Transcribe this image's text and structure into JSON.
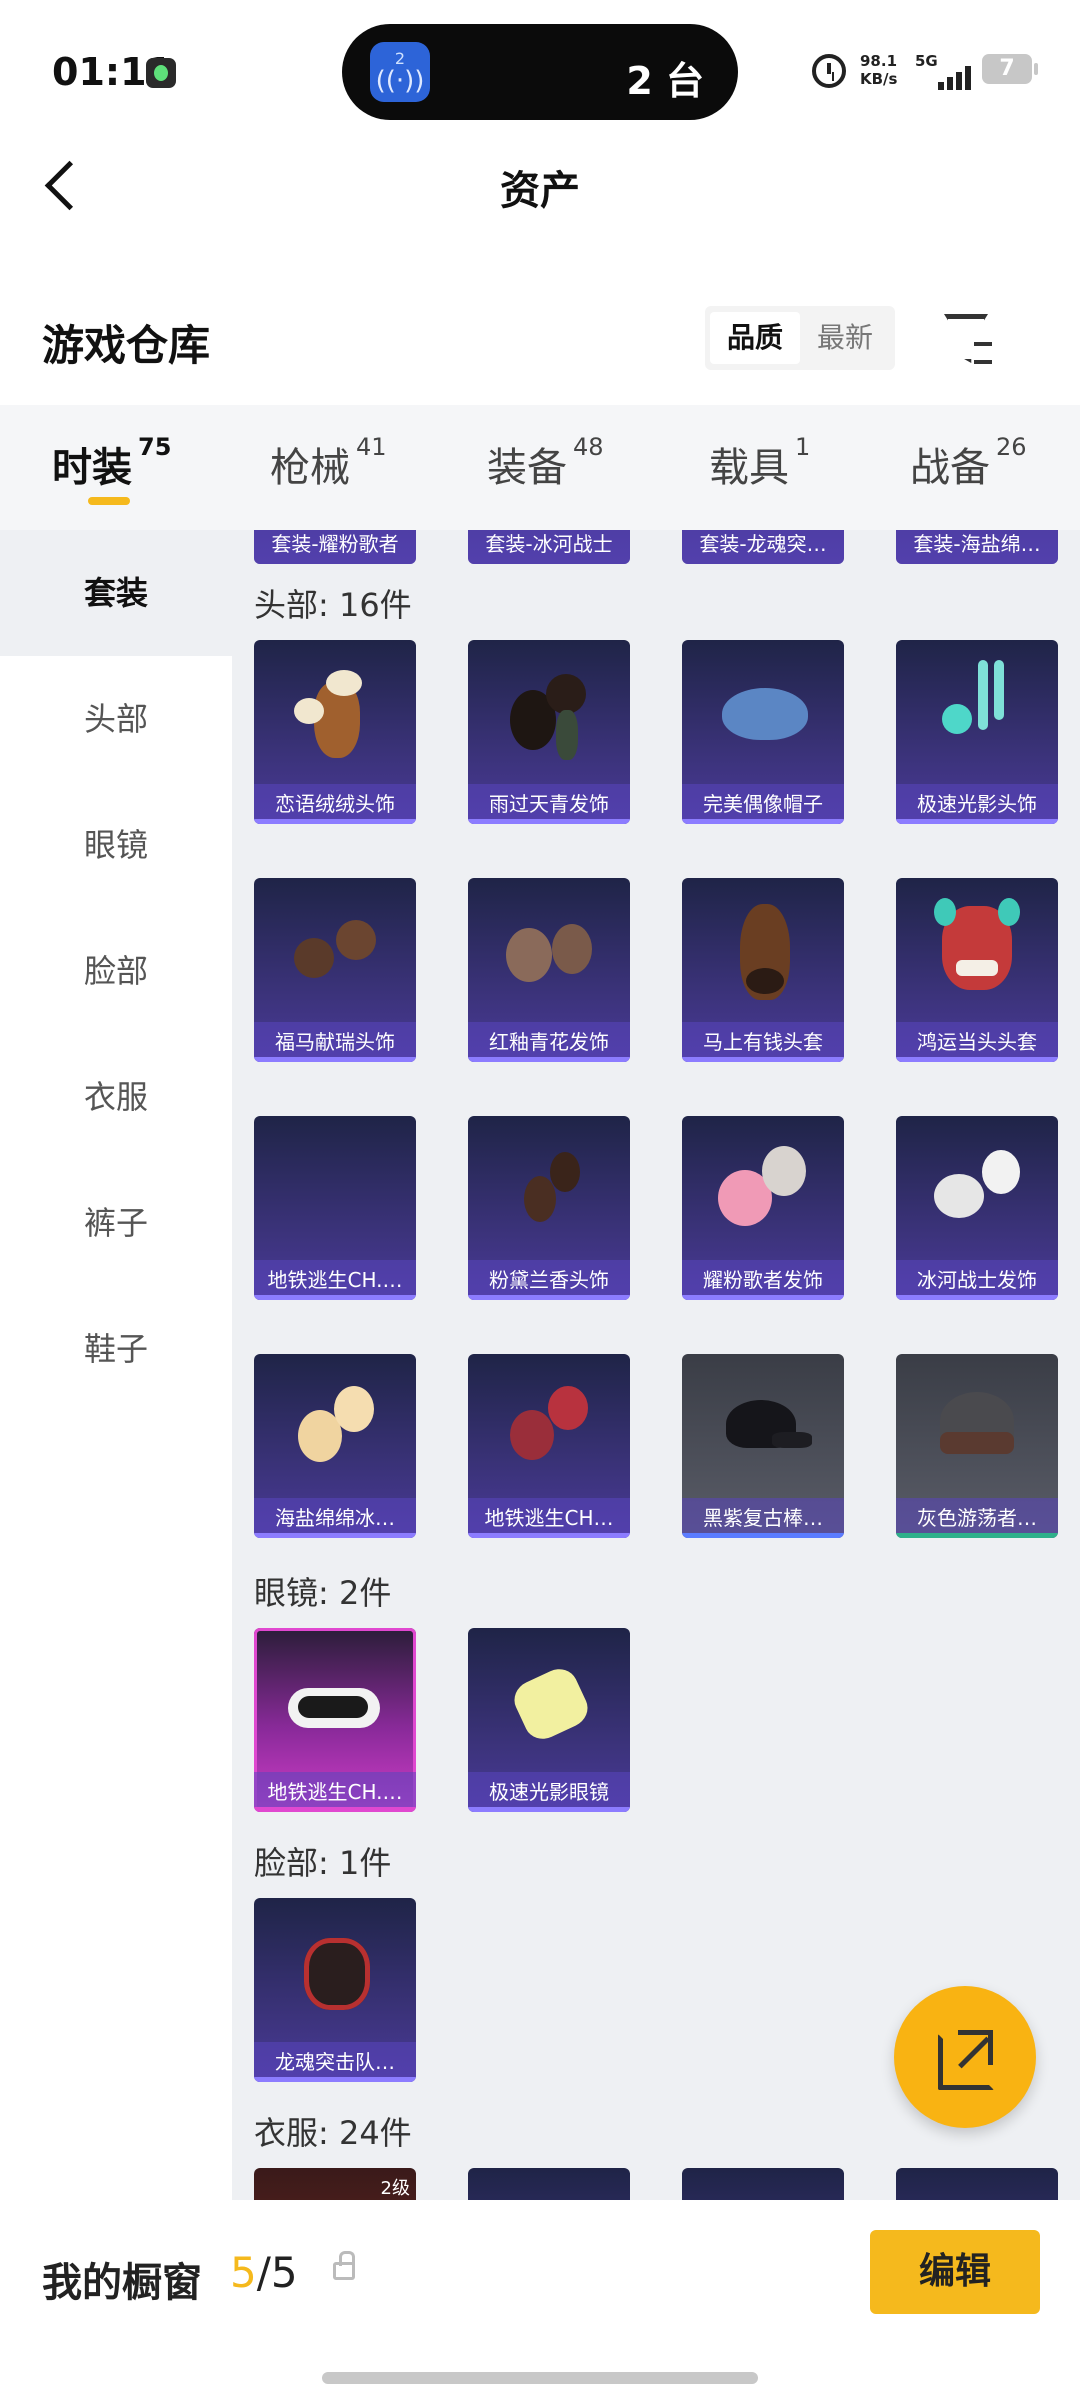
{
  "status_bar": {
    "time": "01:11",
    "island_icon_number": "2",
    "island_text": "2 台",
    "net_speed": "98.1",
    "net_unit": "KB/s",
    "signal": "5G",
    "battery": "7"
  },
  "header": {
    "title": "资产"
  },
  "warehouse": {
    "title": "游戏仓库",
    "sort_options": [
      "品质",
      "最新"
    ],
    "sort_selected": "品质"
  },
  "tabs": [
    {
      "label": "时装",
      "count": "75"
    },
    {
      "label": "枪械",
      "count": "41"
    },
    {
      "label": "装备",
      "count": "48"
    },
    {
      "label": "载具",
      "count": "1"
    },
    {
      "label": "战备",
      "count": "26"
    }
  ],
  "active_tab": "时装",
  "sidebar": {
    "items": [
      "套装",
      "头部",
      "眼镜",
      "脸部",
      "衣服",
      "裤子",
      "鞋子"
    ],
    "active": "套装"
  },
  "top_partial_captions": [
    "套装-耀粉歌者",
    "套装-冰河战士",
    "套装-龙魂突…",
    "套装-海盐绵…"
  ],
  "groups": {
    "head": {
      "label": "头部: 16件",
      "items": [
        "恋语绒绒头饰",
        "雨过天青发饰",
        "完美偶像帽子",
        "极速光影头饰",
        "福马献瑞头饰",
        "红釉青花发饰",
        "马上有钱头套",
        "鸿运当头头套",
        "地铁逃生CH.…",
        "粉黛兰香头饰",
        "耀粉歌者发饰",
        "冰河战士发饰",
        "海盐绵绵冰…",
        "地铁逃生CH…",
        "黑紫复古棒…",
        "灰色游荡者…"
      ]
    },
    "glasses": {
      "label": "眼镜: 2件",
      "items": [
        "地铁逃生CH.…",
        "极速光影眼镜"
      ]
    },
    "face": {
      "label": "脸部: 1件",
      "items": [
        "龙魂突击队…"
      ]
    },
    "clothes": {
      "label": "衣服: 24件",
      "first_badge": "2级"
    }
  },
  "showcase": {
    "label": "我的橱窗",
    "current": "5",
    "total": "5",
    "edit_label": "编辑"
  }
}
